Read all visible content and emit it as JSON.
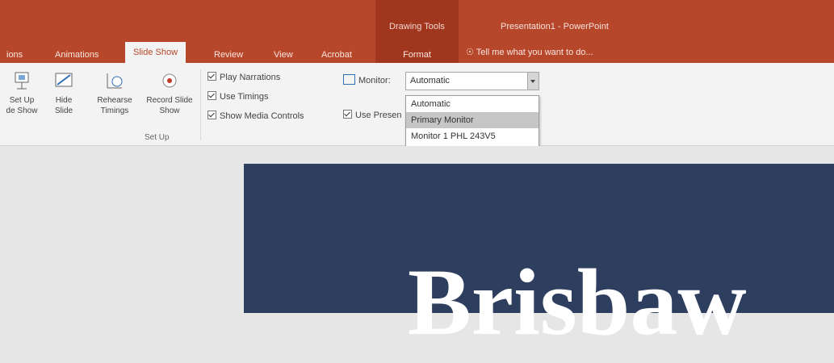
{
  "window": {
    "title": "Presentation1 - PowerPoint"
  },
  "context_group": {
    "label": "Drawing Tools",
    "tab": "Format"
  },
  "tabs": [
    {
      "label": "ions"
    },
    {
      "label": "Animations"
    },
    {
      "label": "Slide Show",
      "active": true
    },
    {
      "label": "Review"
    },
    {
      "label": "View"
    },
    {
      "label": "Acrobat"
    }
  ],
  "tell_me": "Tell me what you want to do...",
  "ribbon": {
    "buttons": [
      {
        "label1": "Set Up",
        "label2": "de Show",
        "icon": "setup-slideshow-icon"
      },
      {
        "label1": "Hide",
        "label2": "Slide",
        "icon": "hide-slide-icon"
      },
      {
        "label1": "Rehearse",
        "label2": "Timings",
        "icon": "rehearse-timings-icon"
      },
      {
        "label1": "Record Slide",
        "label2": "Show",
        "icon": "record-slide-show-icon"
      }
    ],
    "group_label": "Set Up",
    "checkboxes": [
      {
        "label": "Play Narrations",
        "checked": true
      },
      {
        "label": "Use Timings",
        "checked": true
      },
      {
        "label": "Show Media Controls",
        "checked": true
      }
    ],
    "monitor": {
      "label": "Monitor:",
      "value": "Automatic",
      "options": [
        "Automatic",
        "Primary Monitor",
        "Monitor 1 PHL 243V5"
      ],
      "highlighted_index": 1
    },
    "presenter": {
      "label": "Use Presen",
      "checked": true
    }
  },
  "slide": {
    "title": "Brisbaw",
    "bg": "#2d3e5e"
  },
  "colors": {
    "accent": "#b7472a",
    "context": "#a0361e"
  }
}
